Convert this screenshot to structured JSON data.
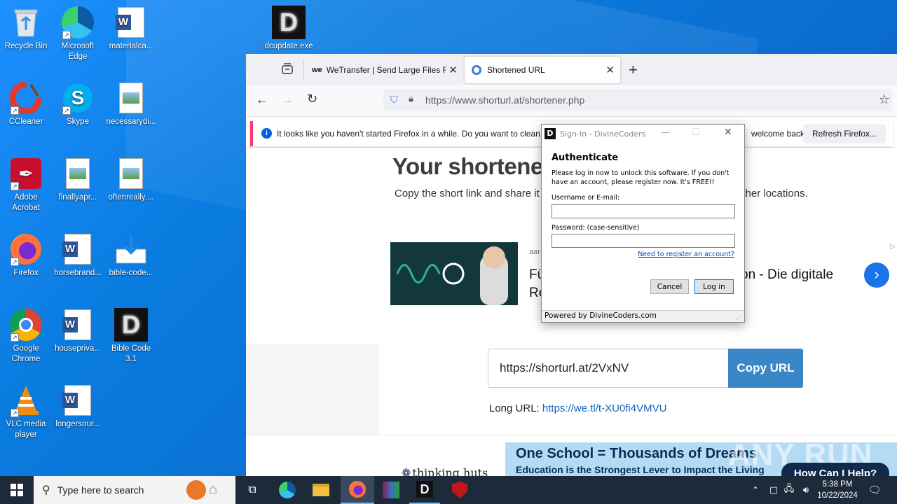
{
  "desktop": {
    "icons": [
      {
        "label": "Recycle Bin"
      },
      {
        "label": "Microsoft Edge"
      },
      {
        "label": "materialca..."
      },
      {
        "label": "dcupdate.exe"
      },
      {
        "label": "CCleaner"
      },
      {
        "label": "Skype"
      },
      {
        "label": "necessarydi..."
      },
      {
        "label": "Adobe Acrobat"
      },
      {
        "label": "finallyapr..."
      },
      {
        "label": "oftenreally...."
      },
      {
        "label": "Firefox"
      },
      {
        "label": "horsebrand..."
      },
      {
        "label": "bible-code..."
      },
      {
        "label": "Google Chrome"
      },
      {
        "label": "housepriva..."
      },
      {
        "label": "Bible Code 3.1"
      },
      {
        "label": "VLC media player"
      },
      {
        "label": "longersour..."
      }
    ]
  },
  "browser": {
    "tabs": [
      {
        "label": "WeTransfer | Send Large Files Fa"
      },
      {
        "label": "Shortened URL"
      }
    ],
    "url": "https://www.shorturl.at/shortener.php",
    "url_domain": "shorturl.at",
    "notice": {
      "text": "It looks like you haven't started Firefox in a while. Do you want to clean",
      "text_tail": "welcome back!",
      "button": "Refresh Firefox..."
    },
    "page": {
      "heading": "Your shortenec",
      "subtext": "Copy the short link and share it",
      "subtext_tail": "other locations.",
      "ad": {
        "source": "aar",
        "line1_start": "Fü",
        "line1_end": "on - Die digitale",
        "line2": "Re"
      },
      "short_url": "https://shorturl.at/2VxNV",
      "copy_button": "Copy URL",
      "long_url_label": "Long URL:",
      "long_url": "https://we.tl/t-XU0fi4VMVU",
      "footer_logo": "thinking huts",
      "banner_title": "One School = Thousands of Dreams",
      "banner_sub": "Education is the Strongest Lever to Impact the Living",
      "help_button": "How Can I Help?",
      "watermark": "ANY RUN"
    }
  },
  "dialog": {
    "title": "Sign-In - DivineCoders",
    "heading": "Authenticate",
    "description": "Please log in now to unlock this software. If you don't have an account, please register now. It's FREE!!",
    "username_label": "Username or E-mail:",
    "password_label": "Password: (case-sensitive)",
    "register_link": "Need to register an account?",
    "cancel": "Cancel",
    "login": "Log in",
    "footer": "Powered by DivineCoders.com"
  },
  "taskbar": {
    "search_placeholder": "Type here to search",
    "time": "5:38 PM",
    "date": "10/22/2024"
  }
}
